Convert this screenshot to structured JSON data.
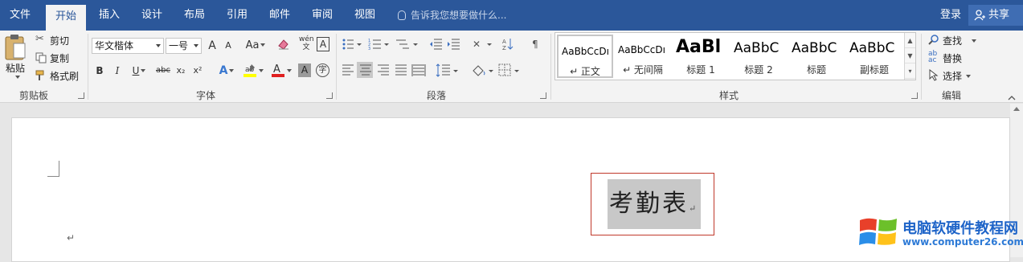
{
  "menu": {
    "tabs": [
      "文件",
      "开始",
      "插入",
      "设计",
      "布局",
      "引用",
      "邮件",
      "审阅",
      "视图"
    ],
    "active_tab": "开始",
    "tell_me": "告诉我您想要做什么...",
    "login": "登录",
    "share": "共享"
  },
  "clipboard": {
    "paste": "粘贴",
    "cut": "剪切",
    "copy": "复制",
    "format_painter": "格式刷",
    "label": "剪贴板"
  },
  "font": {
    "name": "华文楷体",
    "size": "一号",
    "label": "字体",
    "grow": "A",
    "shrink": "A",
    "case": "Aa",
    "bold": "B",
    "italic": "I",
    "underline": "U",
    "strike": "abc",
    "subscript": "x₂",
    "superscript": "x²"
  },
  "paragraph": {
    "label": "段落"
  },
  "styles": {
    "label": "样式",
    "items": [
      {
        "sample": "AaBbCcDı",
        "name": "↵ 正文"
      },
      {
        "sample": "AaBbCcDı",
        "name": "↵ 无间隔"
      },
      {
        "sample": "AaBl",
        "name": "标题 1"
      },
      {
        "sample": "AaBbC",
        "name": "标题 2"
      },
      {
        "sample": "AaBbC",
        "name": "标题"
      },
      {
        "sample": "AaBbC",
        "name": "副标题"
      }
    ]
  },
  "editing": {
    "label": "编辑",
    "find": "查找",
    "replace": "替换",
    "select": "选择"
  },
  "document": {
    "title": "考勤表",
    "para_mark": "↵"
  },
  "watermark": {
    "text": "电脑软硬件教程网",
    "url": "www.computer26.com"
  },
  "colors": {
    "accent": "#2b579a",
    "highlight": "#ffff00",
    "font_color": "#e02020",
    "title_border": "#c0392b"
  }
}
